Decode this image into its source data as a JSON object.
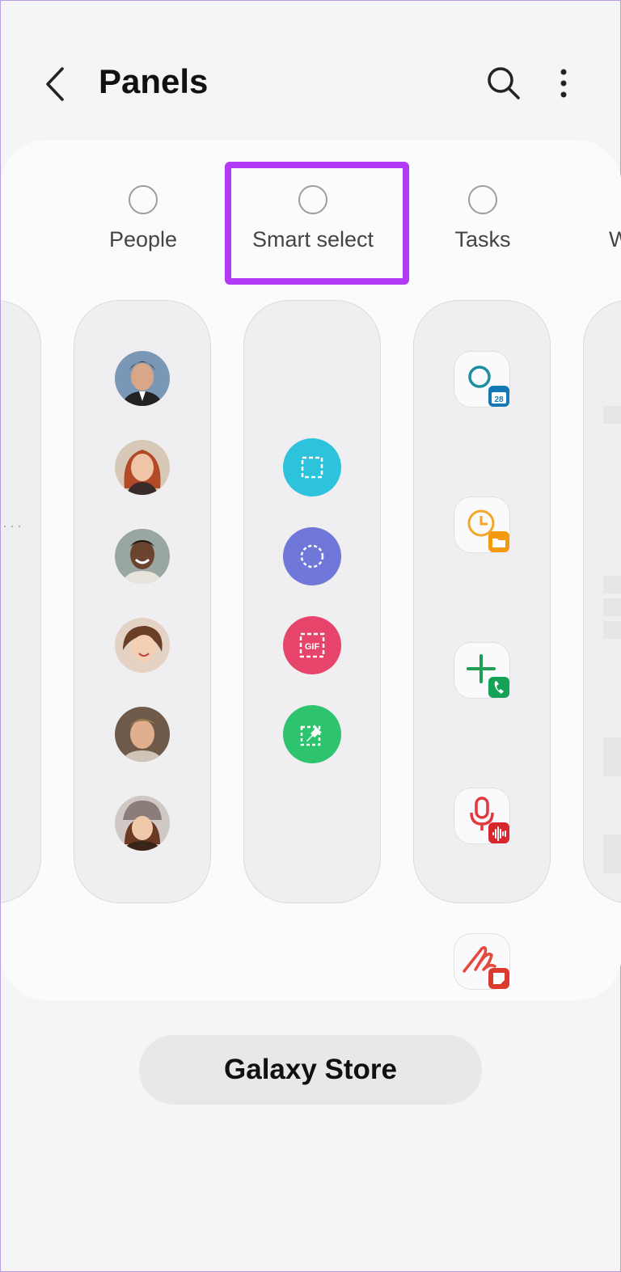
{
  "header": {
    "title": "Panels"
  },
  "panels": [
    {
      "label": "People"
    },
    {
      "label": "Smart select"
    },
    {
      "label": "Tasks"
    },
    {
      "label": "W"
    }
  ],
  "people_count": 6,
  "smart_select_tools": [
    {
      "name": "rectangle-select-icon",
      "color": "#2dc3dc"
    },
    {
      "name": "oval-select-icon",
      "color": "#6f77d8"
    },
    {
      "name": "animation-gif-icon",
      "color": "#e6446a",
      "text": "GIF"
    },
    {
      "name": "pin-to-screen-icon",
      "color": "#2ec36f"
    }
  ],
  "tasks": [
    {
      "name": "calendar-search-icon",
      "badge": "28"
    },
    {
      "name": "clock-folder-icon"
    },
    {
      "name": "add-contact-call-icon"
    },
    {
      "name": "voice-recorder-icon"
    },
    {
      "name": "notes-icon"
    },
    {
      "name": "add-contact-icon"
    }
  ],
  "footer": {
    "store_label": "Galaxy Store"
  }
}
